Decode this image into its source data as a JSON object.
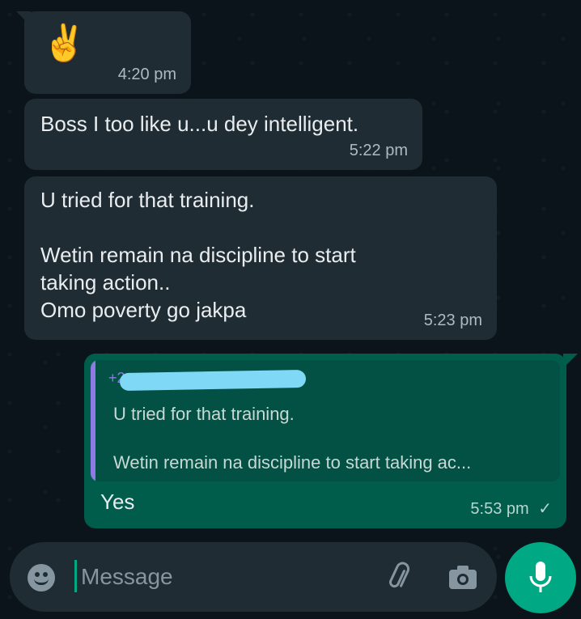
{
  "messages": [
    {
      "type": "incoming",
      "text": "✌️",
      "time": "4:20 pm"
    },
    {
      "type": "incoming",
      "text": "Boss I too like u...u dey intelligent.",
      "time": "5:22 pm"
    },
    {
      "type": "incoming",
      "text": "U tried for that training.\n\nWetin remain na discipline to start\ntaking action..\nOmo poverty go jakpa",
      "time": "5:23 pm"
    },
    {
      "type": "outgoing",
      "quote": {
        "author_prefix": "+2",
        "text": "U tried for that training.\n\nWetin remain na discipline to start taking ac..."
      },
      "text": "Yes",
      "time": "5:53 pm",
      "status": "✓"
    }
  ],
  "composer": {
    "placeholder": "Message"
  },
  "icons": {
    "emoji": "emoji-icon",
    "attach": "paperclip-icon",
    "camera": "camera-icon",
    "mic": "microphone-icon"
  },
  "colors": {
    "background": "#0b141a",
    "incoming_bubble": "#202c33",
    "outgoing_bubble": "#005c4b",
    "accent": "#00a884"
  }
}
